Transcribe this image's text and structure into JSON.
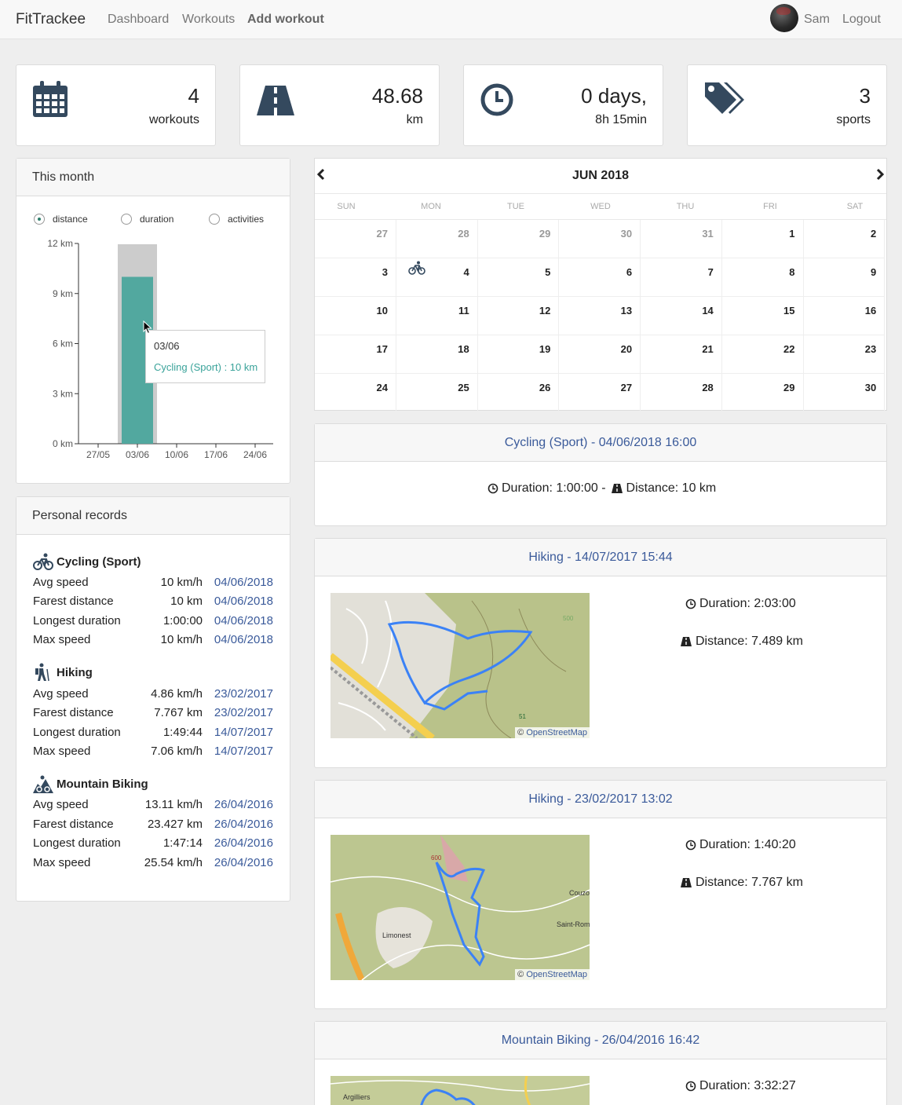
{
  "navbar": {
    "brand": "FitTrackee",
    "links": [
      "Dashboard",
      "Workouts",
      "Add workout"
    ],
    "user": "Sam",
    "logout": "Logout"
  },
  "stats": [
    {
      "icon": "calendar-icon",
      "value": "4",
      "label": "workouts"
    },
    {
      "icon": "road-icon",
      "value": "48.68",
      "label": "km"
    },
    {
      "icon": "clock-icon",
      "value": "0 days,",
      "label": "8h 15min"
    },
    {
      "icon": "tags-icon",
      "value": "3",
      "label": "sports"
    }
  ],
  "month": {
    "title": "This month",
    "options": [
      "distance",
      "duration",
      "activities"
    ],
    "selected": "distance",
    "tooltip": {
      "date": "03/06",
      "text": "Cycling (Sport) : 10 km"
    }
  },
  "chart_data": {
    "type": "bar",
    "categories": [
      "27/05",
      "03/06",
      "10/06",
      "17/06",
      "24/06"
    ],
    "series": [
      {
        "name": "Cycling (Sport)",
        "values": [
          0,
          10,
          0,
          0,
          0
        ]
      }
    ],
    "ylabel": "",
    "yticks": [
      "0 km",
      "3 km",
      "6 km",
      "9 km",
      "12 km"
    ],
    "ylim": [
      0,
      12
    ],
    "highlight_category": "03/06",
    "colors": {
      "bar": "#52a89f",
      "highlight": "#cccccc"
    }
  },
  "records": {
    "title": "Personal records",
    "sports": [
      {
        "name": "Cycling (Sport)",
        "icon": "cycling-icon",
        "rows": [
          {
            "label": "Avg speed",
            "value": "10 km/h",
            "date": "04/06/2018"
          },
          {
            "label": "Farest distance",
            "value": "10 km",
            "date": "04/06/2018"
          },
          {
            "label": "Longest duration",
            "value": "1:00:00",
            "date": "04/06/2018"
          },
          {
            "label": "Max speed",
            "value": "10 km/h",
            "date": "04/06/2018"
          }
        ]
      },
      {
        "name": "Hiking",
        "icon": "hiking-icon",
        "rows": [
          {
            "label": "Avg speed",
            "value": "4.86 km/h",
            "date": "23/02/2017"
          },
          {
            "label": "Farest distance",
            "value": "7.767 km",
            "date": "23/02/2017"
          },
          {
            "label": "Longest duration",
            "value": "1:49:44",
            "date": "14/07/2017"
          },
          {
            "label": "Max speed",
            "value": "7.06 km/h",
            "date": "14/07/2017"
          }
        ]
      },
      {
        "name": "Mountain Biking",
        "icon": "mountain-biking-icon",
        "rows": [
          {
            "label": "Avg speed",
            "value": "13.11 km/h",
            "date": "26/04/2016"
          },
          {
            "label": "Farest distance",
            "value": "23.427 km",
            "date": "26/04/2016"
          },
          {
            "label": "Longest duration",
            "value": "1:47:14",
            "date": "26/04/2016"
          },
          {
            "label": "Max speed",
            "value": "25.54 km/h",
            "date": "26/04/2016"
          }
        ]
      }
    ]
  },
  "calendar": {
    "month": "JUN 2018",
    "daynames": [
      "SUN",
      "MON",
      "TUE",
      "WED",
      "THU",
      "FRI",
      "SAT"
    ],
    "weeks": [
      [
        "27",
        "28",
        "29",
        "30",
        "31",
        "1",
        "2"
      ],
      [
        "3",
        "4",
        "5",
        "6",
        "7",
        "8",
        "9"
      ],
      [
        "10",
        "11",
        "12",
        "13",
        "14",
        "15",
        "16"
      ],
      [
        "17",
        "18",
        "19",
        "20",
        "21",
        "22",
        "23"
      ],
      [
        "24",
        "25",
        "26",
        "27",
        "28",
        "29",
        "30"
      ]
    ]
  },
  "workouts": [
    {
      "title": "Cycling (Sport) - 04/06/2018 16:00",
      "duration": "Duration: 1:00:00 -",
      "distance": "Distance: 10 km"
    },
    {
      "title": "Hiking - 14/07/2017 15:44",
      "duration": "Duration: 2:03:00",
      "distance": "Distance: 7.489 km"
    },
    {
      "title": "Hiking - 23/02/2017 13:02",
      "duration": "Duration: 1:40:20",
      "distance": "Distance: 7.767 km"
    },
    {
      "title": "Mountain Biking - 26/04/2016 16:42",
      "duration": "Duration: 3:32:27"
    }
  ],
  "map": {
    "attribution_prefix": "©",
    "attribution_link": "OpenStreetMap",
    "labels1": [
      "500",
      "51"
    ],
    "labels2": [
      "600",
      "Limonest",
      "Saint-Roma",
      "Couzo"
    ],
    "labels3": [
      "Argilliers"
    ]
  }
}
